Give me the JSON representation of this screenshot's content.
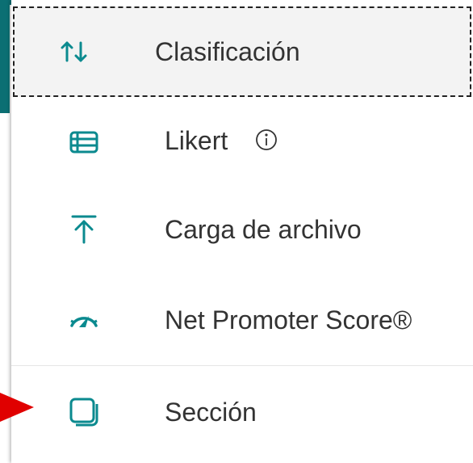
{
  "menu": {
    "items": [
      {
        "label": "Clasificación",
        "icon": "sort-arrows-icon"
      },
      {
        "label": "Likert",
        "icon": "likert-grid-icon",
        "info_icon": "info-icon"
      },
      {
        "label": "Carga de archivo",
        "icon": "upload-icon"
      },
      {
        "label": "Net Promoter Score®",
        "icon": "gauge-icon"
      },
      {
        "label": "Sección",
        "icon": "section-copy-icon"
      }
    ]
  },
  "colors": {
    "accent": "#0b8a8f",
    "pointer": "#e00000",
    "focus_bg": "#f3f3f3"
  }
}
